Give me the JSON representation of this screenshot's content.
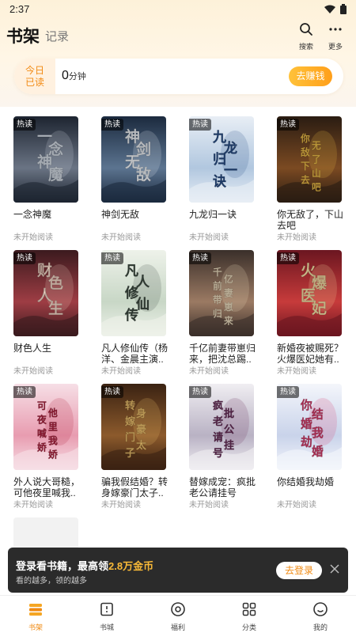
{
  "status_bar": {
    "time": "2:37"
  },
  "header": {
    "tab_shelf": "书架",
    "tab_record": "记录",
    "search_label": "搜索",
    "more_label": "更多"
  },
  "today": {
    "tag_line1": "今日",
    "tag_line2": "已读",
    "value": "0",
    "unit": "分钟",
    "earn_button": "去赚钱"
  },
  "books": [
    {
      "title": "一念神魔",
      "status": "未开始阅读",
      "tag": "热读",
      "cover_text": "一念神魔",
      "palette": [
        "#1d2430",
        "#6a7484",
        "#d8e0ea"
      ]
    },
    {
      "title": "神剑无敌",
      "status": "未开始阅读",
      "tag": "热读",
      "cover_text": "神剑无敌",
      "palette": [
        "#1b2a3e",
        "#5c7490",
        "#f1f4f8"
      ]
    },
    {
      "title": "九龙归一诀",
      "status": "未开始阅读",
      "tag": "热读",
      "cover_text": "九龙归一诀",
      "palette": [
        "#e8eef5",
        "#b1c7df",
        "#274d86"
      ]
    },
    {
      "title": "你无敌了，下山去吧",
      "status": "未开始阅读",
      "tag": "热读",
      "cover_text": "你无敌了下山去吧",
      "palette": [
        "#2a1c12",
        "#7b4a22",
        "#f5c44a"
      ]
    },
    {
      "title": "财色人生",
      "status": "未开始阅读",
      "tag": "热读",
      "cover_text": "财色人生",
      "palette": [
        "#3b1a1e",
        "#9e3d44",
        "#f4d8c8"
      ]
    },
    {
      "title": "凡人修仙传（杨洋、金晨主演..",
      "status": "未开始阅读",
      "tag": "热读",
      "cover_text": "凡人修仙传",
      "palette": [
        "#eef2ea",
        "#c8d7c6",
        "#3c4a40"
      ]
    },
    {
      "title": "千亿前妻带崽归来，把沈总踢..",
      "status": "未开始阅读",
      "tag": "热读",
      "cover_text": "千亿前妻带崽归来",
      "palette": [
        "#3a2f2a",
        "#9b7a63",
        "#f3e3c4"
      ]
    },
    {
      "title": "新婚夜被赐死？火爆医妃她有..",
      "status": "未开始阅读",
      "tag": "热读",
      "cover_text": "火爆医妃",
      "palette": [
        "#6b1620",
        "#c73b3b",
        "#f8e3a8"
      ]
    },
    {
      "title": "外人说大哥糙，可他夜里喊我..",
      "status": "未开始阅读",
      "tag": "热读",
      "cover_text": "可他夜里喊我娇娇",
      "palette": [
        "#f6dfe6",
        "#e89cb0",
        "#b0203e"
      ]
    },
    {
      "title": "骗我假结婚？转身嫁豪门太子..",
      "status": "未开始阅读",
      "tag": "热读",
      "cover_text": "转身嫁豪门太子",
      "palette": [
        "#3a2212",
        "#8c5a2c",
        "#f3c66f"
      ]
    },
    {
      "title": "替嫁成宠：疯批老公请挂号",
      "status": "未开始阅读",
      "tag": "热读",
      "cover_text": "疯批老公请挂号",
      "palette": [
        "#f0eef2",
        "#b9b2c4",
        "#6a2c5a"
      ]
    },
    {
      "title": "你结婚我劫婚",
      "status": "未开始阅读",
      "tag": "热读",
      "cover_text": "你结婚我劫婚",
      "palette": [
        "#f4f6fb",
        "#c9d3ea",
        "#d93a6a"
      ]
    }
  ],
  "toast": {
    "title_prefix": "登录看书籍，最高领",
    "title_highlight": "2.8万金币",
    "subtitle": "看的越多，领的越多",
    "login_button": "去登录"
  },
  "nav": [
    {
      "label": "书架",
      "icon": "bookshelf-icon",
      "active": true
    },
    {
      "label": "书城",
      "icon": "bookstore-icon",
      "active": false
    },
    {
      "label": "福利",
      "icon": "welfare-icon",
      "active": false
    },
    {
      "label": "分类",
      "icon": "category-icon",
      "active": false
    },
    {
      "label": "我的",
      "icon": "profile-icon",
      "active": false
    }
  ],
  "colors": {
    "accent": "#f08a12",
    "gold": "#ffb02a"
  }
}
